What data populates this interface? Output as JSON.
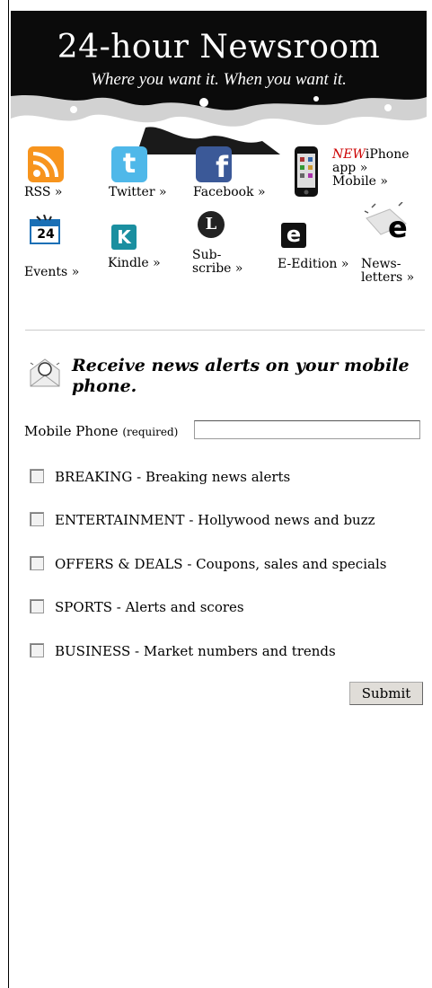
{
  "banner": {
    "title": "24-hour Newsroom",
    "tagline": "Where you want it. When you want it."
  },
  "icons": {
    "rss": "RSS »",
    "twitter": "Twitter »",
    "facebook": "Facebook »",
    "iphone_new": "NEW",
    "iphone_line1": "iPhone",
    "iphone_line2": "app »",
    "iphone_line3": "Mobile »",
    "events": "Events »",
    "kindle": "Kindle »",
    "subscribe_line1": "Sub-",
    "subscribe_line2": "scribe »",
    "eedition": "E-Edition »",
    "newsletters_line1": "News-",
    "newsletters_line2": "letters »",
    "events_badge": "24",
    "kindle_letter": "K",
    "eedition_letter": "e",
    "newsletters_letter": "e",
    "subscribe_letter": "L",
    "twitter_letter": "t",
    "facebook_letter": "f"
  },
  "alerts": {
    "heading": "Receive news alerts on your mobile phone.",
    "phone_label": "Mobile Phone",
    "phone_required": "(required)",
    "phone_value": "",
    "options": [
      "BREAKING - Breaking news alerts",
      "ENTERTAINMENT - Hollywood news and buzz",
      "OFFERS & DEALS - Coupons, sales and specials",
      "SPORTS - Alerts and scores",
      "BUSINESS - Market numbers and trends"
    ],
    "submit_label": "Submit"
  },
  "colors": {
    "rss": "#f7941d",
    "twitter": "#4fb8e9",
    "facebook": "#3b5998",
    "kindle": "#1a8fa0",
    "new_red": "#cc0000"
  }
}
